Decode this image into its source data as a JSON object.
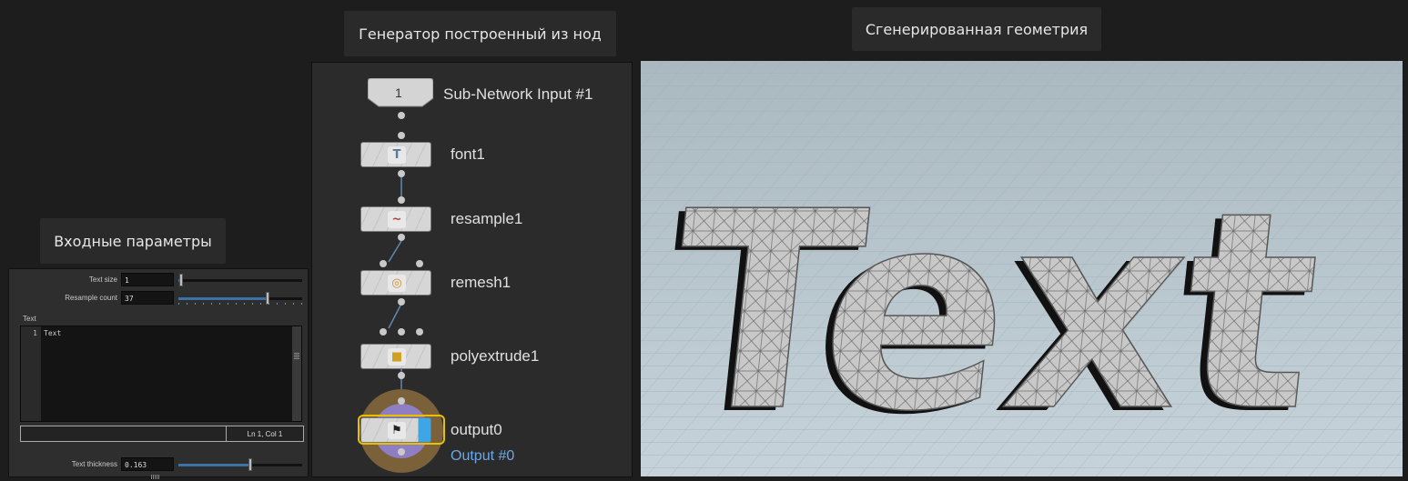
{
  "captions": {
    "inputs": "Входные параметры",
    "generator": "Генератор построенный из нод",
    "geometry": "Сгенерированная геометрия"
  },
  "params": {
    "text_size": {
      "label": "Text size",
      "value": "1",
      "slider": 0.02
    },
    "resample_count": {
      "label": "Resample count",
      "value": "37",
      "slider": 0.72
    },
    "text_label": "Text",
    "editor": {
      "line_number": "1",
      "content": "Text"
    },
    "status": "Ln 1, Col 1",
    "text_thickness": {
      "label": "Text thickness",
      "value": "0.163",
      "slider": 0.58
    }
  },
  "network": {
    "input": {
      "index": "1",
      "label": "Sub-Network Input #1"
    },
    "nodes": [
      {
        "name": "font1",
        "icon": "font-T-icon",
        "glyph": "T"
      },
      {
        "name": "resample1",
        "icon": "resample-wave-icon",
        "glyph": "~"
      },
      {
        "name": "remesh1",
        "icon": "remesh-donut-icon",
        "glyph": "◎"
      },
      {
        "name": "polyextrude1",
        "icon": "polyextrude-box-icon",
        "glyph": "■"
      },
      {
        "name": "output0",
        "icon": "checkered-flag-icon",
        "glyph": "⚑",
        "sublabel": "Output #0"
      }
    ]
  },
  "viewport": {
    "text": "Text",
    "background": "#b9c7cf",
    "mesh_color": "#c8c8c8"
  }
}
